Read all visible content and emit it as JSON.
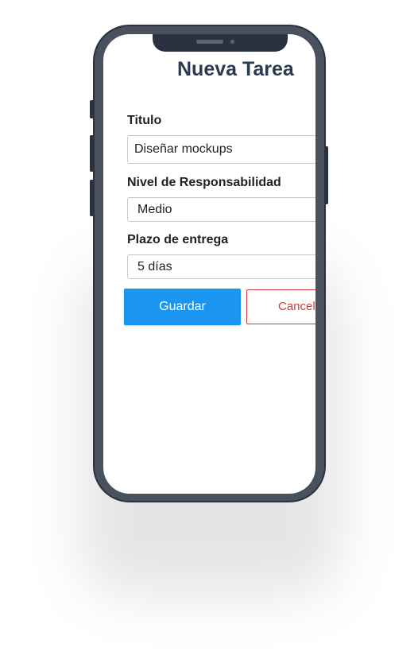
{
  "form": {
    "title": "Nueva Tarea",
    "fields": [
      {
        "label": "Titulo",
        "value": "Diseñar mockups"
      },
      {
        "label": "Nivel de Responsabilidad",
        "value": "Medio"
      },
      {
        "label": "Plazo de entrega",
        "value": "5 días"
      }
    ],
    "save_label": "Guardar",
    "cancel_label": "Cancel"
  },
  "colors": {
    "primary": "#1a96f0",
    "danger": "#d43a3a",
    "title": "#2b3a50",
    "phone_frame": "#4a515e"
  }
}
